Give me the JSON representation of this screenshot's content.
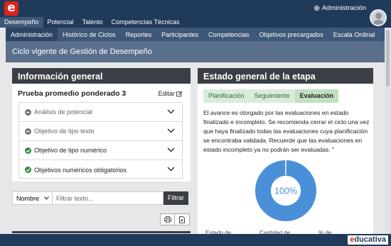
{
  "app": {
    "admin_label": "Administración",
    "brand_prefix": "e",
    "brand_suffix": "ducativa"
  },
  "nav_main": [
    {
      "label": "Desempeño",
      "active": true
    },
    {
      "label": "Potencial",
      "active": false
    },
    {
      "label": "Talento",
      "active": false
    },
    {
      "label": "Competencias Técnicas",
      "active": false
    }
  ],
  "nav_sub": [
    {
      "label": "Administración",
      "active": true
    },
    {
      "label": "Histórico de Ciclos",
      "active": false
    },
    {
      "label": "Reportes",
      "active": false
    },
    {
      "label": "Participantes",
      "active": false
    },
    {
      "label": "Competencias",
      "active": false
    },
    {
      "label": "Objetivos precargados",
      "active": false
    },
    {
      "label": "Escala Ordinal",
      "active": false
    }
  ],
  "page": {
    "title": "Ciclo vigente de Gestión de Desempeño"
  },
  "info": {
    "title": "Información general",
    "subtitle": "Prueba promedio ponderado 3",
    "edit_label": "Editar",
    "items": [
      {
        "label": "Análisis de potencial",
        "status": "pending"
      },
      {
        "label": "Objetivo de tipo texto",
        "status": "pending"
      },
      {
        "label": "Objetivo de tipo numérico",
        "status": "done"
      },
      {
        "label": "Objetivos numéricos obligatorios",
        "status": "done"
      }
    ]
  },
  "filter": {
    "select_value": "Nombre",
    "placeholder": "Filtrar texto...",
    "button": "Filtrar"
  },
  "stage": {
    "title": "Estado general de la etapa",
    "tabs": [
      {
        "label": "Planificación",
        "active": false
      },
      {
        "label": "Seguimiento",
        "active": false
      },
      {
        "label": "Evaluación",
        "active": true
      }
    ],
    "description": "El avance es otorgado por las evaluaciones en estado finalizado e incompleto. Se recomienda cerrar el ciclo una vez que haya finalizado todas las evaluaciones cuya planificación se encontraba validada. Recuerde que las evaluaciones en estado incompleto ya no podrán ser evaluadas. \"",
    "percent_label": "100%",
    "percent": 100,
    "table_headers": [
      "Estado de",
      "Cantidad de",
      "% de"
    ]
  },
  "colors": {
    "navy": "#1f3a5a",
    "accent_blue": "#4a90d9",
    "green": "#2e8b3a",
    "red": "#e2231a"
  }
}
